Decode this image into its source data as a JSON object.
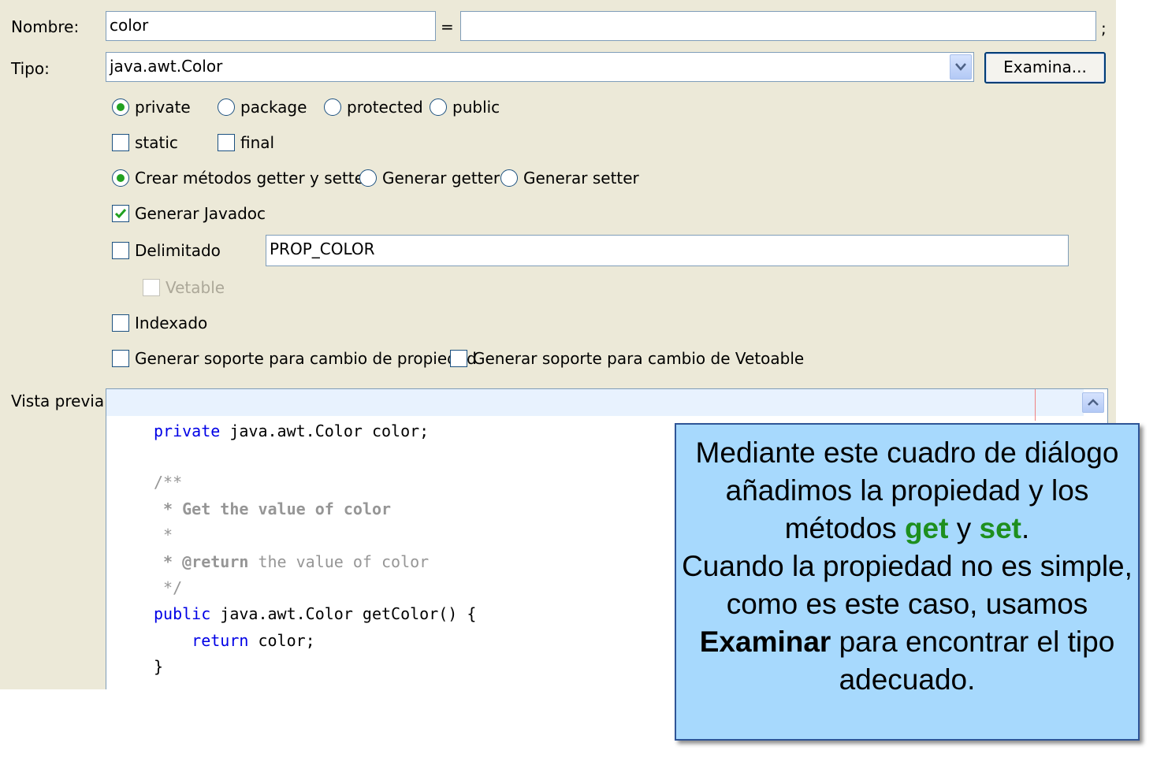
{
  "form": {
    "nombre_label": "Nombre:",
    "nombre_value": "color",
    "equals": "=",
    "initial_value": "",
    "semicolon": ";",
    "tipo_label": "Tipo:",
    "tipo_value": "java.awt.Color",
    "examina_label": "Examina...",
    "access": {
      "private": "private",
      "package": "package",
      "protected": "protected",
      "public": "public",
      "selected": "private"
    },
    "static_label": "static",
    "final_label": "final",
    "accessors": {
      "both": "Crear métodos getter y setter",
      "getter": "Generar getter",
      "setter": "Generar setter",
      "selected": "both"
    },
    "javadoc_label": "Generar Javadoc",
    "javadoc_checked": true,
    "delimitado_label": "Delimitado",
    "delimitado_value": "PROP_COLOR",
    "vetable_label": "Vetable",
    "indexado_label": "Indexado",
    "support_prop_label": "Generar soporte para cambio de propiedad",
    "support_veto_label": "Generar soporte para cambio de Vetoable",
    "preview_label": "Vista previa:"
  },
  "preview": {
    "line1_kw": "private",
    "line1_rest": " java.awt.Color color;",
    "line2": "/**",
    "line3": " * Get the value of color",
    "line4": " *",
    "line5_tag": " * @return",
    "line5_rest": " the value of color",
    "line6": " */",
    "line7_kw": "public",
    "line7_rest": " java.awt.Color getColor() {",
    "line8_kw": "    return",
    "line8_rest": " color;",
    "line9": "}"
  },
  "callout": {
    "p1": "Mediante este cuadro de diálogo añadimos la propiedad y los métodos ",
    "get": "get",
    "y": " y ",
    "set": "set",
    "dot": ".",
    "p2": "Cuando la propiedad no es simple, como es este caso, usamos ",
    "examinar": "Examinar",
    "p3": " para encontrar el tipo adecuado."
  },
  "colors": {
    "dialog_bg": "#ECE9D8",
    "keyword": "#0000E6",
    "comment": "#969696",
    "callout_bg": "#A7D9FD",
    "callout_border": "#2F5597",
    "highlight_green": "#1E8F1E"
  }
}
